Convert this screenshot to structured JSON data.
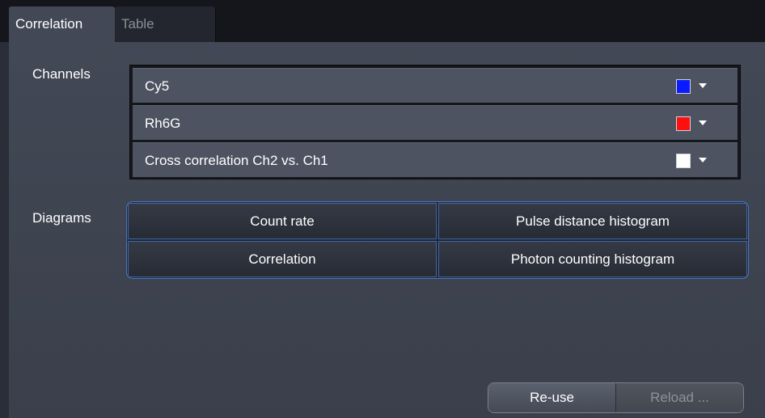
{
  "tabs": [
    {
      "label": "Correlation",
      "active": true
    },
    {
      "label": "Table",
      "active": false
    }
  ],
  "channels": {
    "label": "Channels",
    "items": [
      {
        "name": "Cy5",
        "color": "#0a1cff"
      },
      {
        "name": "Rh6G",
        "color": "#ff1010"
      },
      {
        "name": "Cross correlation Ch2 vs. Ch1",
        "color": "#ffffff"
      }
    ]
  },
  "diagrams": {
    "label": "Diagrams",
    "buttons": [
      "Count rate",
      "Pulse distance histogram",
      "Correlation",
      "Photon counting histogram"
    ]
  },
  "actions": {
    "reuse_label": "Re-use",
    "reload_label": "Reload ...",
    "reload_enabled": false
  },
  "icons": {
    "dropdown": "chevron-down-icon"
  },
  "colors": {
    "accent": "#4a78c2",
    "panel": "#424855",
    "background": "#2a2e38"
  }
}
